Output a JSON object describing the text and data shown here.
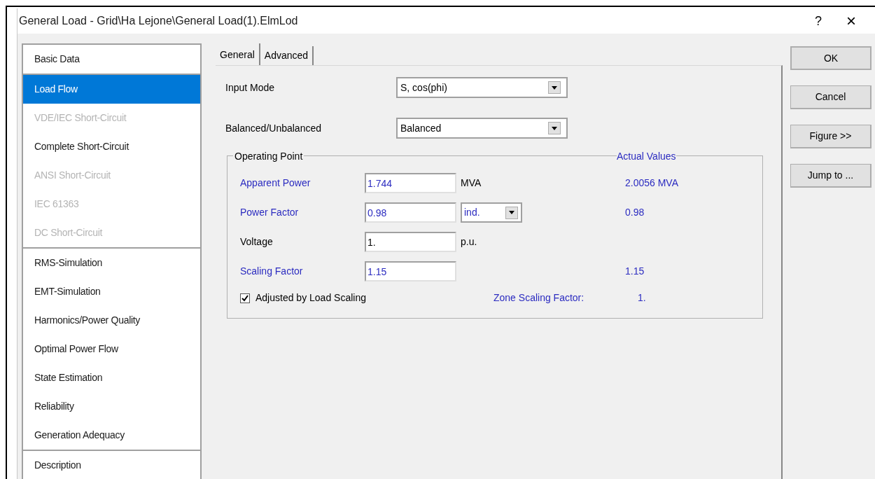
{
  "window": {
    "title": "General Load - Grid\\Ha Lejone\\General Load(1).ElmLod",
    "help": "?",
    "close": "×"
  },
  "sidebar": {
    "groups": [
      {
        "items": [
          {
            "label": "Basic Data",
            "selected": false,
            "disabled": false
          }
        ]
      },
      {
        "items": [
          {
            "label": "Load Flow",
            "selected": true,
            "disabled": false
          },
          {
            "label": "VDE/IEC Short-Circuit",
            "selected": false,
            "disabled": true
          },
          {
            "label": "Complete Short-Circuit",
            "selected": false,
            "disabled": false
          },
          {
            "label": "ANSI Short-Circuit",
            "selected": false,
            "disabled": true
          },
          {
            "label": "IEC 61363",
            "selected": false,
            "disabled": true
          },
          {
            "label": "DC Short-Circuit",
            "selected": false,
            "disabled": true
          }
        ]
      },
      {
        "items": [
          {
            "label": "RMS-Simulation",
            "selected": false,
            "disabled": false
          },
          {
            "label": "EMT-Simulation",
            "selected": false,
            "disabled": false
          },
          {
            "label": "Harmonics/Power Quality",
            "selected": false,
            "disabled": false
          },
          {
            "label": "Optimal Power Flow",
            "selected": false,
            "disabled": false
          },
          {
            "label": "State Estimation",
            "selected": false,
            "disabled": false
          },
          {
            "label": "Reliability",
            "selected": false,
            "disabled": false
          },
          {
            "label": "Generation Adequacy",
            "selected": false,
            "disabled": false
          }
        ]
      },
      {
        "items": [
          {
            "label": "Description",
            "selected": false,
            "disabled": false
          }
        ]
      }
    ]
  },
  "tabs": [
    {
      "label": "General",
      "selected": true
    },
    {
      "label": "Advanced",
      "selected": false
    }
  ],
  "selects": [
    {
      "label": "Input Mode",
      "value": "S, cos(phi)"
    },
    {
      "label": "Balanced/Unbalanced",
      "value": "Balanced"
    }
  ],
  "operating_point": {
    "title": "Operating Point",
    "actual_title": "Actual Values",
    "rows": [
      {
        "label": "Apparent Power",
        "accent": true,
        "value": "1.744",
        "unit": "MVA",
        "actual": "2.0056 MVA"
      },
      {
        "label": "Power Factor",
        "accent": true,
        "value": "0.98",
        "unit_select": "ind.",
        "actual": "0.98"
      },
      {
        "label": "Voltage",
        "accent": false,
        "value": "1.",
        "unit": "p.u."
      },
      {
        "label": "Scaling Factor",
        "accent": true,
        "value": "1.15",
        "actual": "1.15"
      }
    ],
    "checkbox": {
      "label": "Adjusted by Load Scaling",
      "checked": true
    },
    "zone": {
      "label": "Zone Scaling Factor:",
      "value": "1."
    }
  },
  "buttons": [
    "OK",
    "Cancel",
    "Figure >>",
    "Jump to ..."
  ]
}
